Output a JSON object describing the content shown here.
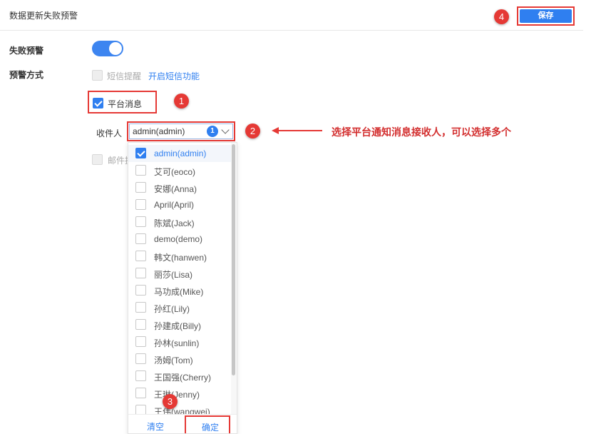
{
  "header": {
    "title": "数据更新失败预警",
    "save_label": "保存"
  },
  "markers": {
    "m1": "1",
    "m2": "2",
    "m3": "3",
    "m4": "4"
  },
  "form": {
    "fail_alert_label": "失败预警",
    "fail_alert_enabled": true,
    "alert_method_label": "预警方式",
    "sms_label": "短信提醒",
    "sms_enable_link": "开启短信功能",
    "platform_label": "平台消息",
    "platform_checked": true,
    "recipient_label": "收件人",
    "recipient_value": "admin(admin)",
    "recipient_count": "1",
    "email_label": "邮件提"
  },
  "annotation": "选择平台通知消息接收人，可以选择多个",
  "dropdown": {
    "items": [
      {
        "label": "admin(admin)",
        "checked": true
      },
      {
        "label": "艾可(eoco)",
        "checked": false
      },
      {
        "label": "安娜(Anna)",
        "checked": false
      },
      {
        "label": "April(April)",
        "checked": false
      },
      {
        "label": "陈斌(Jack)",
        "checked": false
      },
      {
        "label": "demo(demo)",
        "checked": false
      },
      {
        "label": "韩文(hanwen)",
        "checked": false
      },
      {
        "label": "丽莎(Lisa)",
        "checked": false
      },
      {
        "label": "马功成(Mike)",
        "checked": false
      },
      {
        "label": "孙红(Lily)",
        "checked": false
      },
      {
        "label": "孙建成(Billy)",
        "checked": false
      },
      {
        "label": "孙林(sunlin)",
        "checked": false
      },
      {
        "label": "汤姆(Tom)",
        "checked": false
      },
      {
        "label": "王国强(Cherry)",
        "checked": false
      },
      {
        "label": "王琳(Jenny)",
        "checked": false
      },
      {
        "label": "王伟(wangwei)",
        "checked": false
      }
    ],
    "clear_label": "清空",
    "confirm_label": "确定"
  },
  "colors": {
    "accent": "#2f7ff0",
    "marker": "#e53935",
    "annotation": "#d32f2f"
  }
}
